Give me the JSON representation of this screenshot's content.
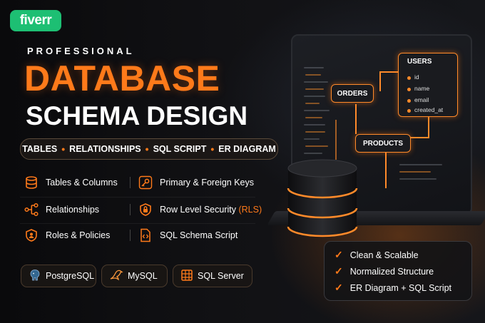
{
  "brand": {
    "logo": "fiverr",
    "color": "#1dbf73"
  },
  "headline": {
    "kicker": "PROFESSIONAL",
    "line1": "DATABASE",
    "line2": "SCHEMA DESIGN"
  },
  "tags": [
    "TABLES",
    "RELATIONSHIPS",
    "SQL SCRIPT",
    "ER DIAGRAM"
  ],
  "features": {
    "left": [
      {
        "label": "Tables & Columns",
        "icon": "database-icon"
      },
      {
        "label": "Relationships",
        "icon": "network-icon"
      },
      {
        "label": "Roles & Policies",
        "icon": "shield-icon"
      }
    ],
    "right": [
      {
        "label": "Primary & Foreign Keys",
        "icon": "key-icon"
      },
      {
        "label": "Row Level Security",
        "suffix": "(RLS)",
        "icon": "lock-shield-icon"
      },
      {
        "label": "SQL Schema Script",
        "icon": "code-file-icon"
      }
    ]
  },
  "databases": [
    {
      "label": "PostgreSQL",
      "icon": "elephant-icon"
    },
    {
      "label": "MySQL",
      "icon": "dolphin-icon"
    },
    {
      "label": "SQL Server",
      "icon": "grid-icon"
    }
  ],
  "diagram": {
    "users": {
      "title": "USERS",
      "fields": [
        "id",
        "name",
        "email",
        "created_at"
      ]
    },
    "orders": "ORDERS",
    "products": "PRODUCTS"
  },
  "benefits": [
    "Clean & Scalable",
    "Normalized Structure",
    "ER Diagram + SQL Script"
  ],
  "colors": {
    "accent": "#ff7a1a",
    "background": "#0b0b0d"
  }
}
